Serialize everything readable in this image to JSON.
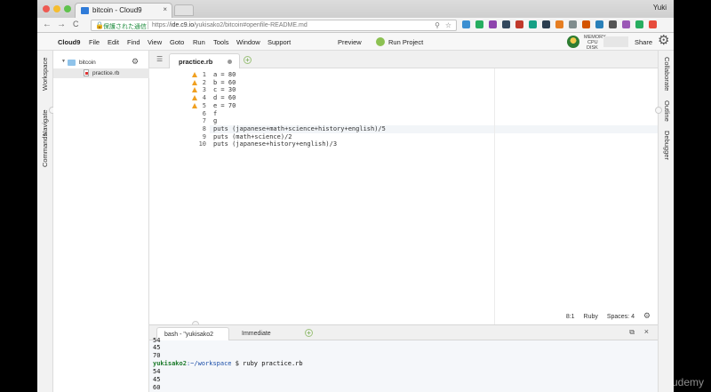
{
  "browser": {
    "tab_title": "bitcoin - Cloud9",
    "tab_close": "×",
    "user": "Yuki",
    "back": "←",
    "forward": "→",
    "reload": "C",
    "secure_label": "保護された通信",
    "url_prefix": "https://",
    "url_host": "ide.c9.io",
    "url_path": "/yukisako2/bitcoin#openfile-README.md",
    "extension_colors": [
      "#3c8fd1",
      "#27ae60",
      "#8e44ad",
      "#34495e",
      "#c0392b",
      "#16a085",
      "#2c3e50",
      "#e67e22",
      "#7f8c8d",
      "#d35400",
      "#2980b9",
      "#555555",
      "#9b59b6",
      "#27ae60",
      "#e74c3c"
    ]
  },
  "menu": {
    "brand": "Cloud9",
    "items": [
      "File",
      "Edit",
      "Find",
      "View",
      "Goto",
      "Run",
      "Tools",
      "Window",
      "Support"
    ],
    "preview": "Preview",
    "run_project": "Run Project",
    "memory": "MEMORY",
    "cpu": "CPU",
    "disk": "DISK",
    "share": "Share"
  },
  "left_panels": [
    "Workspace",
    "Navigate",
    "Commands"
  ],
  "right_panels": [
    "Collaborate",
    "Outline",
    "Debugger"
  ],
  "tree": {
    "folder": "bitcoin",
    "file": "practice.rb"
  },
  "editor": {
    "tab": "practice.rb",
    "lines": [
      {
        "num": "1",
        "warn": true,
        "text": "a = 80"
      },
      {
        "num": "2",
        "warn": true,
        "text": "b = 60"
      },
      {
        "num": "3",
        "warn": true,
        "text": "c = 30"
      },
      {
        "num": "4",
        "warn": true,
        "text": "d = 60"
      },
      {
        "num": "5",
        "warn": true,
        "text": "e = 70"
      },
      {
        "num": "6",
        "warn": false,
        "text": "f"
      },
      {
        "num": "7",
        "warn": false,
        "text": "g"
      },
      {
        "num": "8",
        "warn": false,
        "text": "puts (japanese+math+science+history+english)/5"
      },
      {
        "num": "9",
        "warn": false,
        "text": "puts (math+science)/2"
      },
      {
        "num": "10",
        "warn": false,
        "text": "puts (japanese+history+english)/3"
      }
    ],
    "status_pos": "8:1",
    "status_lang": "Ruby",
    "status_spaces": "Spaces: 4"
  },
  "terminal": {
    "tab1": "bash - \"yukisako2",
    "tab2": "Immediate",
    "lines": [
      "54",
      "45",
      "70"
    ],
    "prompt_user": "yukisako2",
    "prompt_path": ":~/workspace",
    "prompt_cmd": " $ ruby practice.rb",
    "output": [
      "54",
      "45",
      "60"
    ]
  },
  "watermark": "udemy"
}
